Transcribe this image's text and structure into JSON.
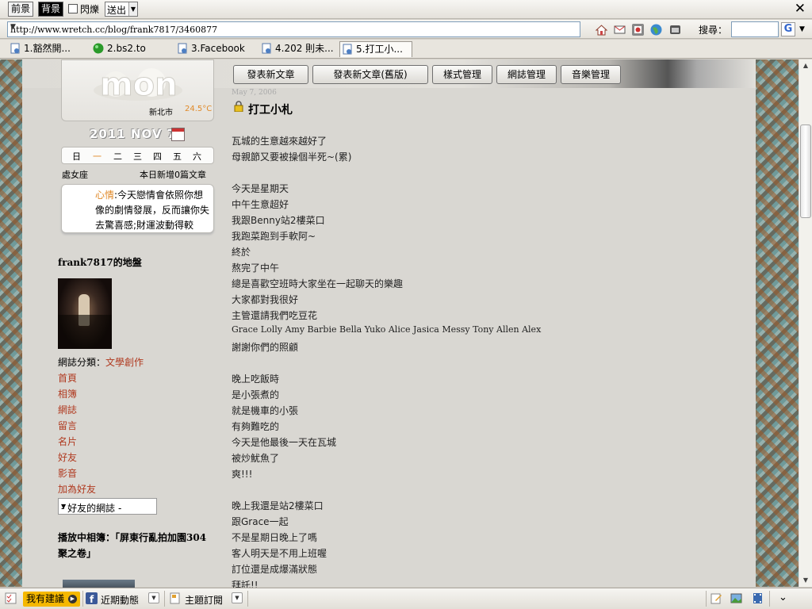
{
  "toolbar": {
    "front_label": "前景",
    "back_label": "背景",
    "blink_label": "閃爍",
    "send_label": "送出"
  },
  "address": {
    "url": "http://www.wretch.cc/blog/frank7817/3460877",
    "search_label": "搜尋："
  },
  "tabs": [
    {
      "label": "1.豁然開..."
    },
    {
      "label": "2.bs2.to"
    },
    {
      "label": "3.Facebook"
    },
    {
      "label": "4.202 則未..."
    },
    {
      "label": "5.打工小..."
    }
  ],
  "sidebar": {
    "city": "新北市",
    "temperature": "24.5°C",
    "date": "2011  NOV  7",
    "weekdays": [
      "日",
      "一",
      "二",
      "三",
      "四",
      "五",
      "六"
    ],
    "zodiac": "處女座",
    "new_posts": "本日新增0篇文章",
    "mood_label": "心情",
    "mood_text": ":今天戀情會依照你想像的劇情發展，反而讓你失去驚喜感;財運波動得較",
    "owner_title": "frank7817的地盤",
    "category_label": "網誌分類：",
    "category_value": "文學創作",
    "links": [
      "首頁",
      "相簿",
      "網誌",
      "留言",
      "名片",
      "好友",
      "影音",
      "加為好友"
    ],
    "friend_select": "- 好友的網誌 -",
    "album_title": "播放中相簿：「屏東行亂拍加園304聚之卷」"
  },
  "main": {
    "buttons": [
      "發表新文章",
      "發表新文章(舊版)",
      "樣式管理",
      "網誌管理",
      "音樂管理"
    ],
    "post_date": "May 7, 2006",
    "post_title": "打工小札",
    "body": [
      "瓦城的生意越來越好了",
      "母親節又要被操個半死~(累)",
      "",
      "今天是星期天",
      "中午生意超好",
      "我跟Benny站2樓菜口",
      "我跑菜跑到手軟阿~",
      "終於",
      "熬完了中午",
      "總是喜歡空班時大家坐在一起聊天的樂趣",
      "大家都對我很好",
      "主管還請我們吃豆花",
      "Grace Lolly Amy Barbie Bella Yuko Alice Jasica Messy Tony Allen Alex",
      "謝謝你們的照顧",
      "",
      "晚上吃飯時",
      "是小張煮的",
      "就是機車的小張",
      "有夠難吃的",
      "今天是他最後一天在瓦城",
      "被炒魷魚了",
      "爽!!!",
      "",
      "晚上我還是站2樓菜口",
      "跟Grace一起",
      "不是星期日晚上了嗎",
      "客人明天是不用上班喔",
      "訂位還是成爆滿狀態",
      "拜託!!"
    ]
  },
  "statusbar": {
    "suggest": "我有建議",
    "recent": "近期動態",
    "subscribe": "主題訂閱"
  },
  "colors": {
    "link": "#b03a20",
    "accent": "#e08a2a",
    "suggest_bg": "#f5b800"
  }
}
